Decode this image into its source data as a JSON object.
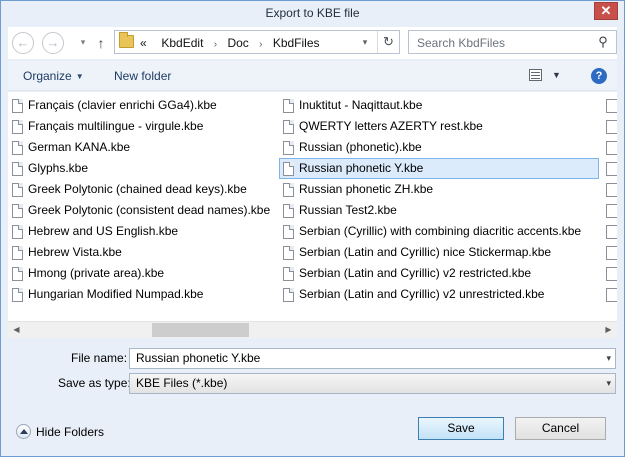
{
  "window": {
    "title": "Export to KBE file",
    "close_label": "✕"
  },
  "nav": {
    "back_icon": "←",
    "forward_icon": "→",
    "dropdown_icon": "▾",
    "up_icon": "↑",
    "address": {
      "prefix": "«",
      "crumbs": [
        "KbdEdit",
        "Doc",
        "KbdFiles"
      ],
      "sep": "›",
      "refresh_icon": "↻"
    },
    "search": {
      "placeholder": "Search KbdFiles",
      "icon": "⚲"
    }
  },
  "toolbar": {
    "organize": "Organize",
    "new_folder": "New folder",
    "arrow": "▼",
    "help": "?"
  },
  "files": {
    "column1": [
      "Français (clavier enrichi GGa4).kbe",
      "Français multilingue - virgule.kbe",
      "German KANA.kbe",
      "Glyphs.kbe",
      "Greek Polytonic (chained dead keys).kbe",
      "Greek Polytonic (consistent dead names).kbe",
      "Hebrew and US English.kbe",
      "Hebrew Vista.kbe",
      "Hmong (private area).kbe",
      "Hungarian Modified Numpad.kbe"
    ],
    "column2": [
      "Inuktitut - Naqittaut.kbe",
      "QWERTY letters AZERTY rest.kbe",
      "Russian (phonetic).kbe",
      "Russian phonetic Y.kbe",
      "Russian phonetic ZH.kbe",
      "Russian Test2.kbe",
      "Serbian (Cyrillic) with combining diacritic accents.kbe",
      "Serbian (Latin and Cyrillic) nice Stickermap.kbe",
      "Serbian (Latin and Cyrillic) v2 restricted.kbe",
      "Serbian (Latin and Cyrillic) v2 unrestricted.kbe"
    ],
    "selected_index_col2": 3
  },
  "scrollbar": {
    "left_icon": "◀",
    "right_icon": "▶"
  },
  "form": {
    "file_name_label": "File name:",
    "file_name_value": "Russian phonetic Y.kbe",
    "save_type_label": "Save as type:",
    "save_type_value": "KBE Files (*.kbe)",
    "dropdown_icon": "▾"
  },
  "footer": {
    "hide_folders": "Hide Folders",
    "save": "Save",
    "cancel": "Cancel"
  }
}
